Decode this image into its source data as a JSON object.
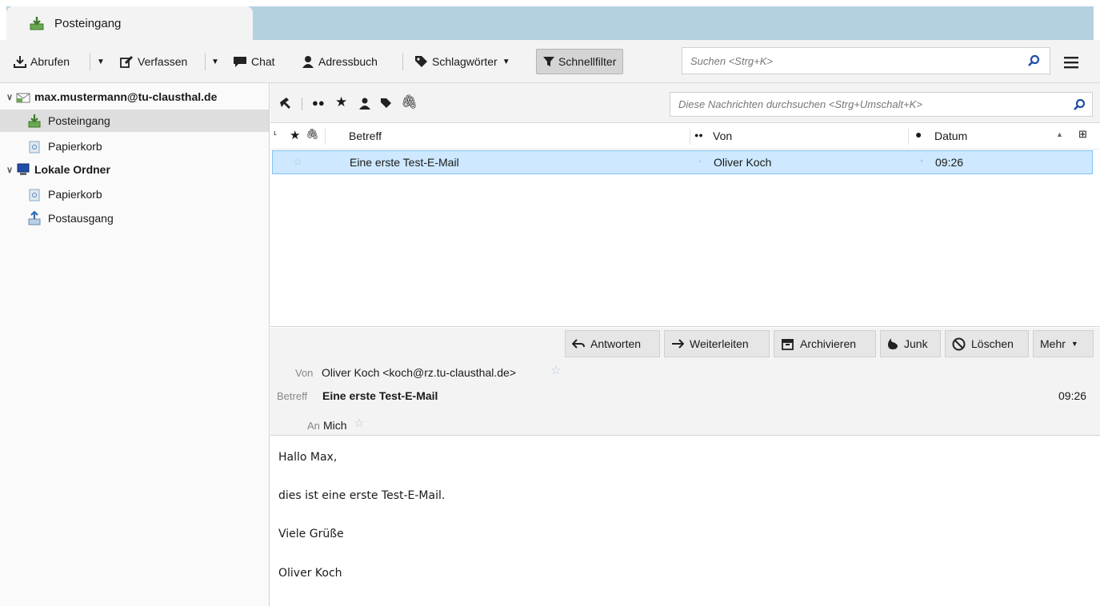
{
  "tabs": [
    {
      "label": "Posteingang",
      "icon": "inbox-download-icon"
    }
  ],
  "toolbar": {
    "get_messages": "Abrufen",
    "compose": "Verfassen",
    "chat": "Chat",
    "address_book": "Adressbuch",
    "tags": "Schlagwörter",
    "quick_filter": "Schnellfilter",
    "search_placeholder": "Suchen <Strg+K>"
  },
  "folders": {
    "account": "max.mustermann@tu-clausthal.de",
    "account_items": [
      "Posteingang",
      "Papierkorb"
    ],
    "local": "Lokale Ordner",
    "local_items": [
      "Papierkorb",
      "Postausgang"
    ]
  },
  "quickfilter": {
    "search_placeholder": "Diese Nachrichten durchsuchen <Strg+Umschalt+K>"
  },
  "columns": {
    "subject": "Betreff",
    "from": "Von",
    "date": "Datum"
  },
  "messages": [
    {
      "subject": "Eine erste Test-E-Mail",
      "from": "Oliver Koch",
      "date": "09:26"
    }
  ],
  "header_buttons": {
    "reply": "Antworten",
    "forward": "Weiterleiten",
    "archive": "Archivieren",
    "junk": "Junk",
    "delete": "Löschen",
    "more": "Mehr"
  },
  "header": {
    "from_label": "Von",
    "from_value": "Oliver Koch <koch@rz.tu-clausthal.de>",
    "subject_label": "Betreff",
    "subject_value": "Eine erste Test-E-Mail",
    "time": "09:26",
    "to_label": "An",
    "to_value": "Mich"
  },
  "body": {
    "lines": [
      "Hallo Max,",
      "dies ist eine erste Test-E-Mail.",
      "Viele Grüße",
      "Oliver Koch"
    ]
  },
  "colors": {
    "accent_tab_strip": "#b4d1e0",
    "selection": "#cde8ff",
    "selection_border": "#84c3f7"
  }
}
